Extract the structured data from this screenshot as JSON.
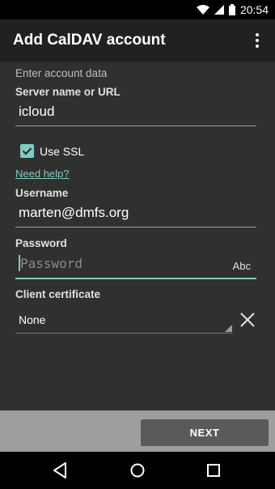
{
  "status_bar": {
    "time": "20:54"
  },
  "app_bar": {
    "title": "Add CalDAV account",
    "overflow_icon": "more-vert-icon"
  },
  "form": {
    "section_heading": "Enter account data",
    "server": {
      "label": "Server name or URL",
      "value": "icloud"
    },
    "ssl": {
      "label": "Use SSL",
      "checked": true
    },
    "help_link": "Need help?",
    "username": {
      "label": "Username",
      "value": "marten@dmfs.org"
    },
    "password": {
      "label": "Password",
      "placeholder": "Password",
      "value": "",
      "keyboard_hint": "Abc"
    },
    "client_certificate": {
      "label": "Client certificate",
      "selected": "None",
      "clear_icon": "close-icon"
    }
  },
  "actions": {
    "next_label": "NEXT"
  },
  "nav_bar": {
    "icons": [
      "back-icon",
      "home-icon",
      "recents-icon"
    ]
  },
  "colors": {
    "accent": "#80cbc4",
    "background": "#303030",
    "app_bar": "#212121"
  }
}
